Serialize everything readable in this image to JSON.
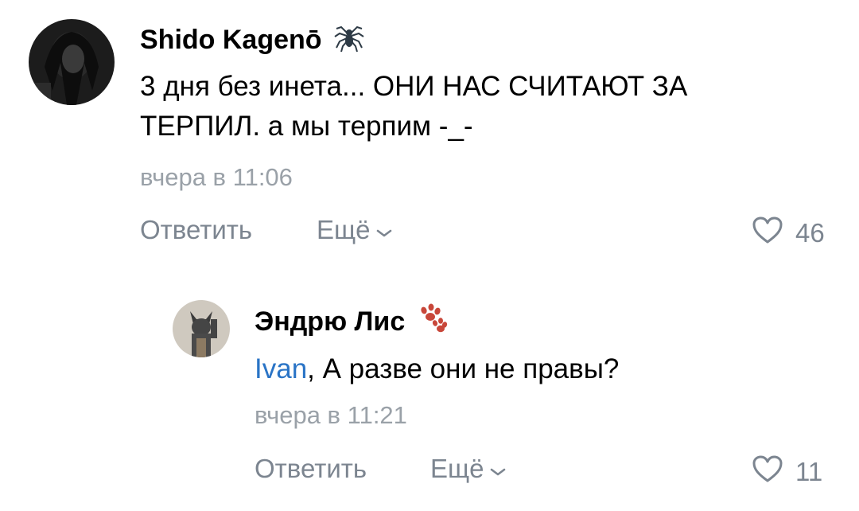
{
  "colors": {
    "mention": "#2a74c6",
    "meta": "#9aa1a8",
    "action": "#7c8590"
  },
  "comments": [
    {
      "author": "Shido Kagenō",
      "badge_icon": "spider-icon",
      "text": "3 дня без инета... ОНИ НАС СЧИТАЮТ ЗА ТЕРПИЛ. а мы терпим -_-",
      "time": "вчера в 11:06",
      "reply_label": "Ответить",
      "more_label": "Ещё",
      "likes": "46"
    },
    {
      "author": "Эндрю Лис",
      "badge_icon": "paw-icon",
      "mention": "Ivan",
      "text": ", А разве они не правы?",
      "time": "вчера в 11:21",
      "reply_label": "Ответить",
      "more_label": "Ещё",
      "likes": "11"
    }
  ]
}
